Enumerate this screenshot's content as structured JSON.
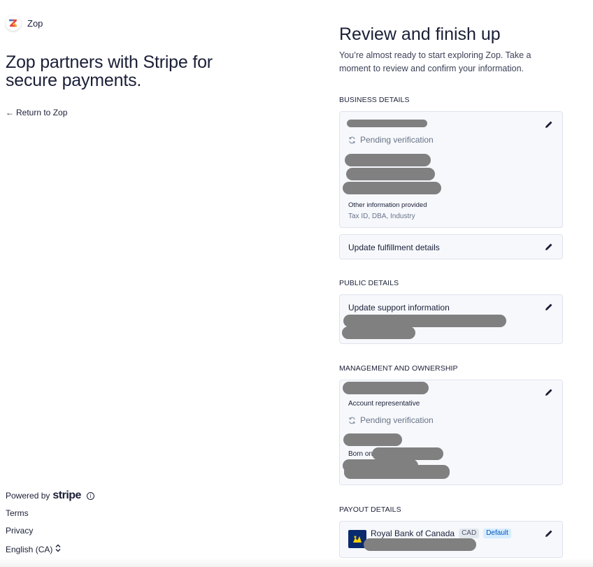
{
  "brand": {
    "name": "Zop"
  },
  "left": {
    "headline": "Zop partners with Stripe for secure payments.",
    "return_link": "Return to Zop",
    "arrow_glyph": "←"
  },
  "footer": {
    "powered_by": "Powered by",
    "stripe": "stripe",
    "info_glyph": "i",
    "links": {
      "terms": "Terms",
      "privacy": "Privacy"
    },
    "language": "English (CA)",
    "language_glyph": "⌃⌄"
  },
  "review": {
    "title": "Review and finish up",
    "subtitle": "You’re almost ready to start exploring Zop. Take a moment to review and confirm your information."
  },
  "sections": {
    "business": {
      "label": "BUSINESS DETAILS",
      "status": "Pending verification",
      "other_info_label": "Other information provided",
      "other_info_value": "Tax ID, DBA, Industry",
      "fulfillment": "Update fulfillment details"
    },
    "public": {
      "label": "PUBLIC DETAILS",
      "support": "Update support information"
    },
    "management": {
      "label": "MANAGEMENT AND OWNERSHIP",
      "role": "Account representative",
      "status": "Pending verification",
      "born_on": "Born on"
    },
    "payout": {
      "label": "PAYOUT DETAILS",
      "bank_name": "Royal Bank of Canada",
      "currency": "CAD",
      "default_badge": "Default"
    }
  },
  "icons": [
    "zop-logo-icon",
    "arrow-left-icon",
    "info-icon",
    "chevron-updown-icon",
    "edit-pencil-icon",
    "sync-icon",
    "rbc-logo-icon"
  ],
  "colors": {
    "text": "#1a1f36",
    "muted": "#697386",
    "card_bg": "#f6f8fc",
    "card_border": "#dfe3eb",
    "redaction": "#808080",
    "default_badge": "#0055bc"
  }
}
